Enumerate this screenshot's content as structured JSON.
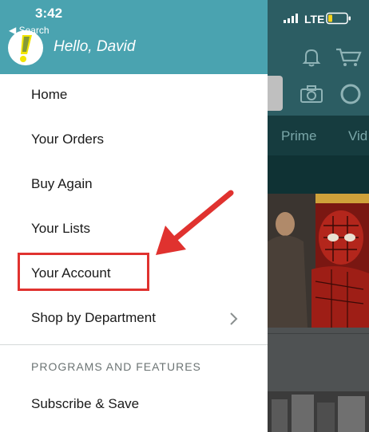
{
  "status_bar": {
    "time": "3:42",
    "back_label": "◀ Search",
    "carrier": "LTE"
  },
  "drawer": {
    "greeting": "Hello, David",
    "menu": [
      {
        "label": "Home"
      },
      {
        "label": "Your Orders"
      },
      {
        "label": "Buy Again"
      },
      {
        "label": "Your Lists"
      },
      {
        "label": "Your Account"
      },
      {
        "label": "Shop by Department"
      }
    ],
    "section_title": "PROGRAMS AND FEATURES",
    "section_items": [
      {
        "label": "Subscribe & Save"
      }
    ]
  },
  "background_app": {
    "tabs": [
      "Prime",
      "Vid"
    ]
  },
  "colors": {
    "header_teal": "#4aa3b0",
    "highlight_red": "#e0322f",
    "logo_yellow": "#f2e500",
    "dark_teal": "#2c5d63"
  },
  "icons": [
    "signal-bars-icon",
    "battery-icon",
    "bell-icon",
    "cart-icon",
    "camera-icon",
    "alexa-icon",
    "chevron-right-icon",
    "app-logo-icon"
  ]
}
